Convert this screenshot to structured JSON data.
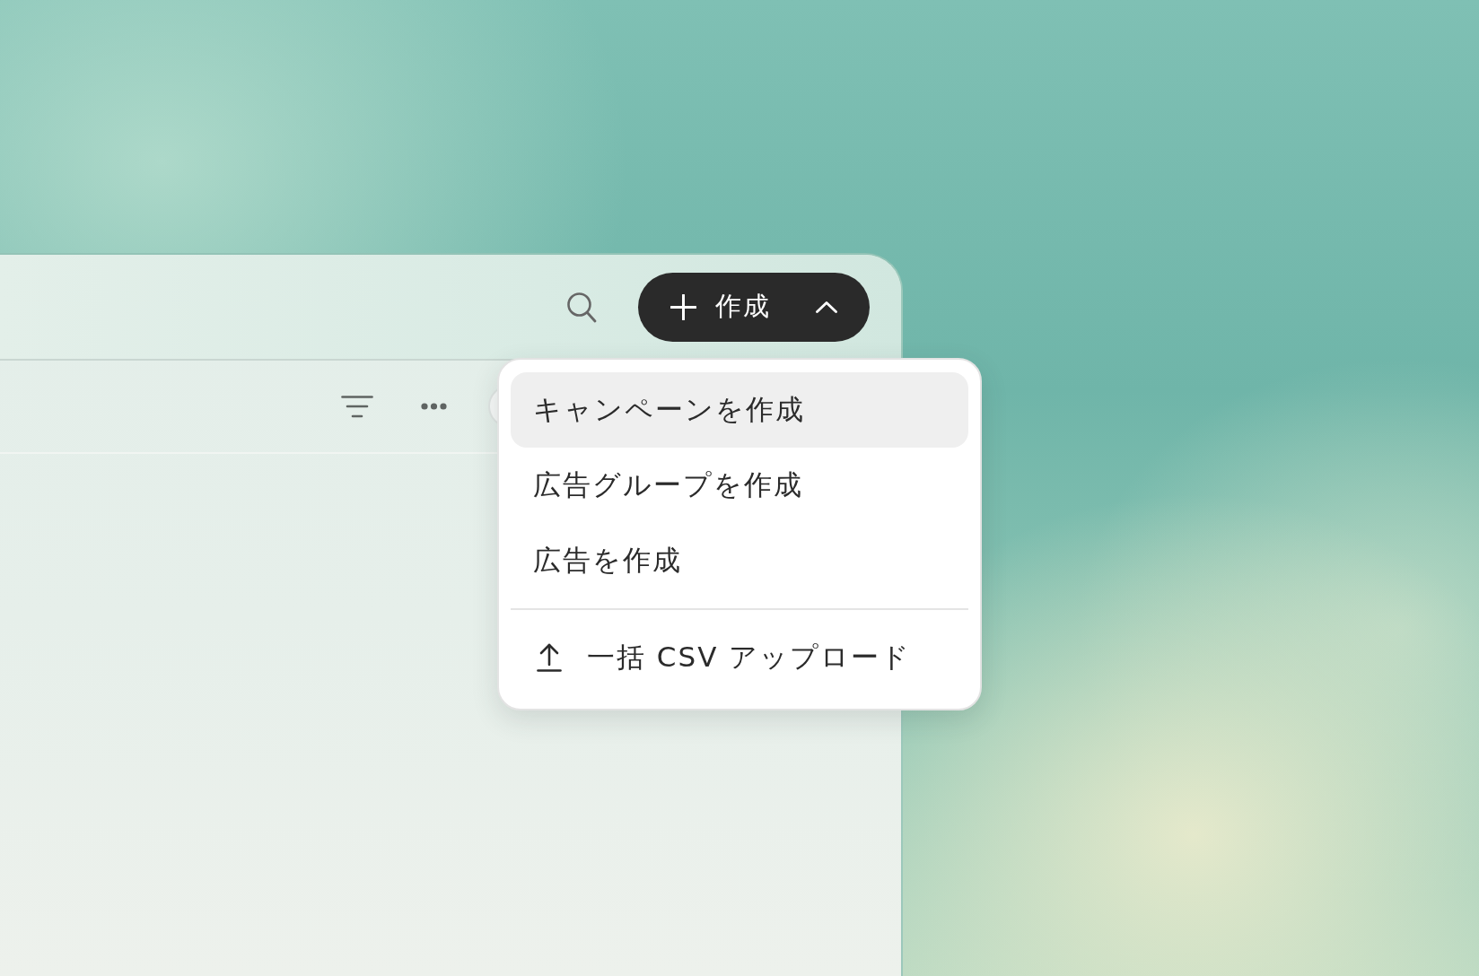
{
  "toolbar": {
    "create_button": {
      "label": "作成",
      "expanded": true
    }
  },
  "create_menu": {
    "items": [
      {
        "kind": "action",
        "label": "キャンペーンを作成",
        "selected": true
      },
      {
        "kind": "action",
        "label": "広告グループを作成",
        "selected": false
      },
      {
        "kind": "action",
        "label": "広告を作成",
        "selected": false
      },
      {
        "kind": "upload",
        "label": "一括 CSV アップロード",
        "selected": false
      }
    ]
  }
}
